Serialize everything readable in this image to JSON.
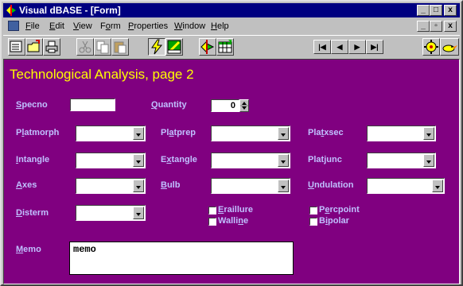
{
  "window": {
    "title": "Visual dBASE - [Form]",
    "controls": {
      "minimize": "_",
      "maximize": "□",
      "close": "x"
    },
    "doc_controls": {
      "minimize": "_",
      "restore": "▫",
      "close": "x"
    }
  },
  "menu": {
    "items": [
      {
        "accel": "F",
        "rest": "ile"
      },
      {
        "accel": "E",
        "rest": "dit"
      },
      {
        "accel": "V",
        "rest": "iew"
      },
      {
        "pre": "F",
        "accel": "o",
        "rest": "rm"
      },
      {
        "accel": "P",
        "rest": "roperties"
      },
      {
        "accel": "W",
        "rest": "indow"
      },
      {
        "accel": "H",
        "rest": "elp"
      }
    ]
  },
  "toolbar": {
    "nav": {
      "first": "|◀",
      "prev": "◀",
      "next": "▶",
      "last": "▶|"
    }
  },
  "form": {
    "title": "Technological Analysis, page 2",
    "labels": {
      "specno": {
        "accel": "S",
        "rest": "pecno"
      },
      "quantity": {
        "accel": "Q",
        "rest": "uantity"
      },
      "platmorph": {
        "pre": "P",
        "accel": "l",
        "rest": "atmorph"
      },
      "platprep": {
        "pre": "Pl",
        "accel": "a",
        "rest": "tprep"
      },
      "platxsec": {
        "pre": "Pla",
        "accel": "t",
        "rest": "xsec"
      },
      "intangle": {
        "accel": "I",
        "rest": "ntangle"
      },
      "extangle": {
        "pre": "E",
        "accel": "x",
        "rest": "tangle"
      },
      "platjunc": {
        "pre": "Plat",
        "accel": "j",
        "rest": "unc"
      },
      "axes": {
        "accel": "A",
        "rest": "xes"
      },
      "bulb": {
        "accel": "B",
        "rest": "ulb"
      },
      "undulation": {
        "accel": "U",
        "rest": "ndulation"
      },
      "disterm": {
        "accel": "D",
        "rest": "isterm"
      },
      "eraillure": {
        "accel": "E",
        "rest": "raillure"
      },
      "percpoint": {
        "pre": "P",
        "accel": "e",
        "rest": "rcpoint"
      },
      "walline": {
        "pre": "Walli",
        "accel": "n",
        "rest": "e"
      },
      "bipolar": {
        "pre": "B",
        "accel": "i",
        "rest": "polar"
      },
      "memo": {
        "accel": "M",
        "rest": "emo"
      }
    },
    "values": {
      "specno": "",
      "quantity": "0",
      "memo": "memo"
    },
    "checkboxes": {
      "eraillure": false,
      "percpoint": false,
      "walline": false,
      "bipolar": false
    }
  }
}
